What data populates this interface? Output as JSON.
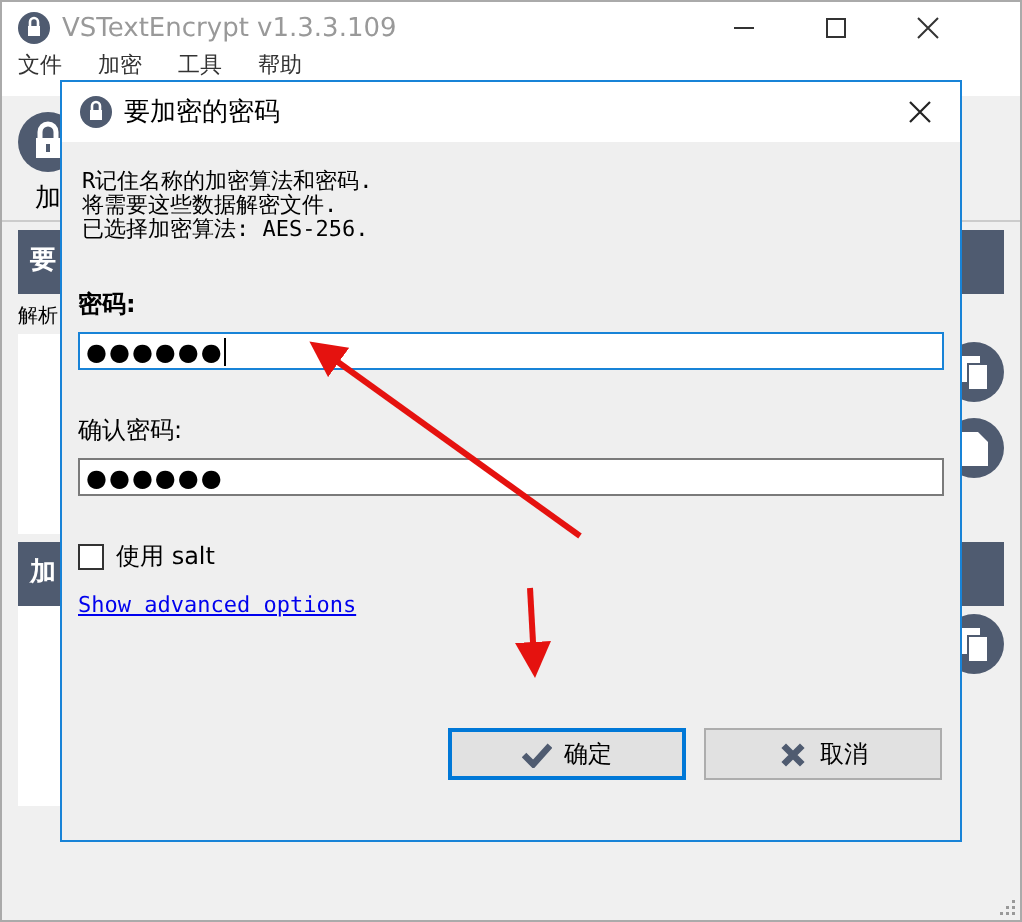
{
  "window": {
    "title": "VSTextEncrypt v1.3.3.109"
  },
  "menu": [
    "文件",
    "加密",
    "工具",
    "帮助"
  ],
  "toolbar": {
    "label": "加"
  },
  "sections": [
    {
      "header": "要",
      "label": "解析"
    },
    {
      "header": "加"
    }
  ],
  "dialog": {
    "title": "要加密的密码",
    "info": [
      "R记住名称的加密算法和密码.",
      "将需要这些数据解密文件.",
      "已选择加密算法: AES-256."
    ],
    "password_label": "密码:",
    "password": {
      "value": "●●●●●●",
      "focused": true
    },
    "confirm_label": "确认密码:",
    "confirm": {
      "value": "●●●●●●",
      "focused": false
    },
    "salt": {
      "label": "使用 salt",
      "checked": false
    },
    "advanced_link": "Show advanced options",
    "buttons": [
      {
        "kind": "ok",
        "label": "确定",
        "default": true
      },
      {
        "kind": "cancel",
        "label": "取消",
        "default": false
      }
    ]
  }
}
